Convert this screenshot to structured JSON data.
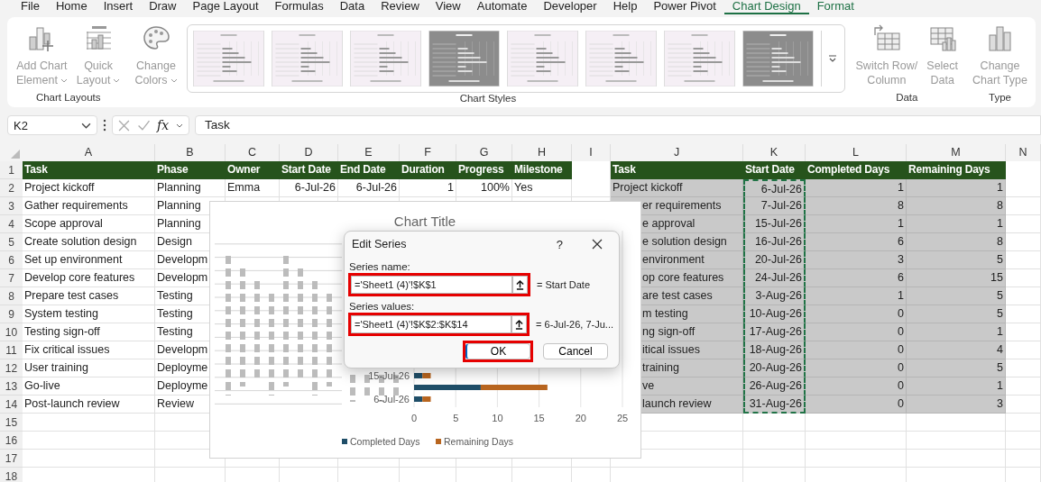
{
  "menu_tabs": [
    {
      "label": "File",
      "selected": false,
      "contextual": false
    },
    {
      "label": "Home",
      "selected": false,
      "contextual": false
    },
    {
      "label": "Insert",
      "selected": false,
      "contextual": false
    },
    {
      "label": "Draw",
      "selected": false,
      "contextual": false
    },
    {
      "label": "Page Layout",
      "selected": false,
      "contextual": false
    },
    {
      "label": "Formulas",
      "selected": false,
      "contextual": false
    },
    {
      "label": "Data",
      "selected": false,
      "contextual": false
    },
    {
      "label": "Review",
      "selected": false,
      "contextual": false
    },
    {
      "label": "View",
      "selected": false,
      "contextual": false
    },
    {
      "label": "Automate",
      "selected": false,
      "contextual": false
    },
    {
      "label": "Developer",
      "selected": false,
      "contextual": false
    },
    {
      "label": "Help",
      "selected": false,
      "contextual": false
    },
    {
      "label": "Power Pivot",
      "selected": false,
      "contextual": false
    },
    {
      "label": "Chart Design",
      "selected": true,
      "contextual": true
    },
    {
      "label": "Format",
      "selected": false,
      "contextual": true
    }
  ],
  "ribbon": {
    "groups": [
      {
        "label": "Chart Layouts",
        "buttons": [
          {
            "kind": "add-chart",
            "lines": [
              "Add Chart",
              "Element"
            ],
            "dropdown": true,
            "disabled": true
          },
          {
            "kind": "quick-layout",
            "lines": [
              "Quick",
              "Layout"
            ],
            "dropdown": true,
            "disabled": true
          }
        ]
      },
      {
        "label": "Chart Styles",
        "buttons": [
          {
            "kind": "palette",
            "lines": [
              "Change",
              "Colors"
            ],
            "dropdown": true,
            "disabled": true
          }
        ],
        "gallery": [
          {
            "kind": "light"
          },
          {
            "kind": "light"
          },
          {
            "kind": "light"
          },
          {
            "kind": "dark"
          },
          {
            "kind": "light"
          },
          {
            "kind": "light"
          },
          {
            "kind": "light"
          },
          {
            "kind": "dark"
          }
        ]
      },
      {
        "label": "Data",
        "buttons": [
          {
            "kind": "switch",
            "lines": [
              "Switch Row/",
              "Column"
            ],
            "dropdown": false,
            "disabled": true
          },
          {
            "kind": "select-data",
            "lines": [
              "Select",
              "Data"
            ],
            "dropdown": false,
            "disabled": true
          }
        ]
      },
      {
        "label": "Type",
        "buttons": [
          {
            "kind": "chart-type",
            "lines": [
              "Change",
              "Chart Type"
            ],
            "dropdown": false,
            "disabled": true
          }
        ]
      }
    ]
  },
  "formula_bar": {
    "name_box": "K2",
    "function_label": "fx",
    "formula": "Task"
  },
  "sheet": {
    "columns": [
      "A",
      "B",
      "C",
      "D",
      "E",
      "F",
      "G",
      "H",
      "I",
      "J",
      "K",
      "L",
      "M",
      "N"
    ],
    "row_numbers": [
      "1",
      "2",
      "3",
      "4",
      "5",
      "6",
      "7",
      "8",
      "9",
      "10",
      "11",
      "12",
      "13",
      "14",
      "15",
      "16",
      "17",
      "18"
    ],
    "left_table": {
      "header": [
        "Task",
        "Phase",
        "Owner",
        "Start Date",
        "End Date",
        "Duration",
        "Progress",
        "Milestone"
      ],
      "rows": [
        [
          "Project kickoff",
          "Planning",
          "Emma",
          "6-Jul-26",
          "6-Jul-26",
          "1",
          "100%",
          "Yes"
        ],
        [
          "Gather requirements",
          "Planning"
        ],
        [
          "Scope approval",
          "Planning"
        ],
        [
          "Create solution design",
          "Design"
        ],
        [
          "Set up environment",
          "Developm"
        ],
        [
          "Develop core features",
          "Developm"
        ],
        [
          "Prepare test cases",
          "Testing"
        ],
        [
          "System testing",
          "Testing"
        ],
        [
          "Testing sign-off",
          "Testing"
        ],
        [
          "Fix critical issues",
          "Developm"
        ],
        [
          "User training",
          "Deployme"
        ],
        [
          "Go-live",
          "Deployme"
        ],
        [
          "Post-launch review",
          "Review"
        ]
      ]
    },
    "right_table": {
      "header": [
        "Task",
        "Start Date",
        "Completed Days",
        "Remaining Days"
      ],
      "rows": [
        [
          "Project kickoff",
          "6-Jul-26",
          "1",
          "1"
        ],
        [
          "er requirements",
          "7-Jul-26",
          "8",
          "8"
        ],
        [
          "e approval",
          "15-Jul-26",
          "1",
          "1"
        ],
        [
          "e solution design",
          "16-Jul-26",
          "6",
          "8"
        ],
        [
          "environment",
          "20-Jul-26",
          "3",
          "5"
        ],
        [
          "op core features",
          "24-Jul-26",
          "6",
          "15"
        ],
        [
          "are test cases",
          "3-Aug-26",
          "1",
          "5"
        ],
        [
          "m testing",
          "10-Aug-26",
          "0",
          "5"
        ],
        [
          "ng sign-off",
          "17-Aug-26",
          "0",
          "1"
        ],
        [
          "itical issues",
          "18-Aug-26",
          "0",
          "4"
        ],
        [
          "training",
          "20-Aug-26",
          "0",
          "5"
        ],
        [
          "ve",
          "26-Aug-26",
          "0",
          "1"
        ],
        [
          "launch review",
          "31-Aug-26",
          "0",
          "3"
        ]
      ]
    }
  },
  "chart": {
    "chart_data": {
      "type": "bar",
      "title": "Chart Title",
      "orientation": "horizontal",
      "stacked": true,
      "categories": [
        "15-Jul-26",
        null,
        "6-Jul-26"
      ],
      "series": [
        {
          "name": "Completed Days",
          "color": "#1f4e68",
          "values": [
            1,
            8,
            1
          ]
        },
        {
          "name": "Remaining Days",
          "color": "#b8651f",
          "values": [
            1,
            8,
            1
          ]
        }
      ],
      "xlim": [
        0,
        25
      ],
      "xticks": [
        0,
        5,
        10,
        15,
        20,
        25
      ],
      "grid": true,
      "legend": true
    }
  },
  "dialog": {
    "title": "Edit Series",
    "help": "?",
    "fields": [
      {
        "label": "Series name:",
        "value": "='Sheet1 (4)'!$K$1",
        "result": "= Start Date",
        "highlighted": true
      },
      {
        "label": "Series values:",
        "value": "='Sheet1 (4)'!$K$2:$K$14",
        "result": "= 6-Jul-26, 7-Ju...",
        "highlighted": true
      }
    ],
    "buttons": [
      {
        "label": "OK",
        "highlighted": true
      },
      {
        "label": "Cancel",
        "highlighted": false
      }
    ]
  }
}
